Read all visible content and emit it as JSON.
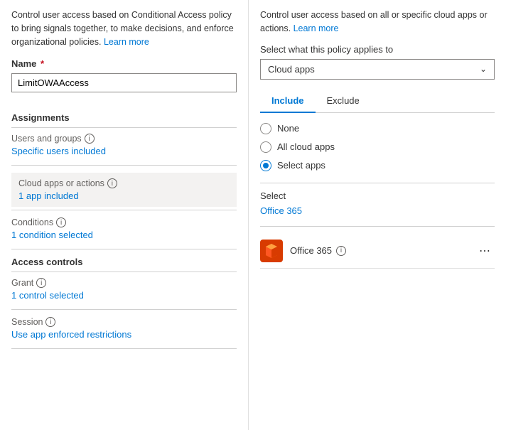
{
  "left": {
    "intro": "Control user access based on Conditional Access policy to bring signals together, to make decisions, and enforce organizational policies.",
    "intro_link": "Learn more",
    "name_label": "Name",
    "name_required": true,
    "name_value": "LimitOWAAccess",
    "assignments_heading": "Assignments",
    "users_groups_label": "Users and groups",
    "users_groups_value": "Specific users included",
    "cloud_apps_label": "Cloud apps or actions",
    "cloud_apps_value": "1 app included",
    "conditions_label": "Conditions",
    "conditions_value": "1 condition selected",
    "access_controls_heading": "Access controls",
    "grant_label": "Grant",
    "grant_value": "1 control selected",
    "session_label": "Session",
    "session_value": "Use app enforced restrictions"
  },
  "right": {
    "intro": "Control user access based on all or specific cloud apps or actions.",
    "intro_link": "Learn more",
    "dropdown_label": "Select what this policy applies to",
    "dropdown_value": "Cloud apps",
    "tabs": [
      {
        "id": "include",
        "label": "Include",
        "active": true
      },
      {
        "id": "exclude",
        "label": "Exclude",
        "active": false
      }
    ],
    "radio_options": [
      {
        "id": "none",
        "label": "None",
        "selected": false
      },
      {
        "id": "all",
        "label": "All cloud apps",
        "selected": false
      },
      {
        "id": "select",
        "label": "Select apps",
        "selected": true
      }
    ],
    "select_label": "Select",
    "office365_link": "Office 365",
    "app_item": {
      "name": "Office 365",
      "info": true
    }
  }
}
